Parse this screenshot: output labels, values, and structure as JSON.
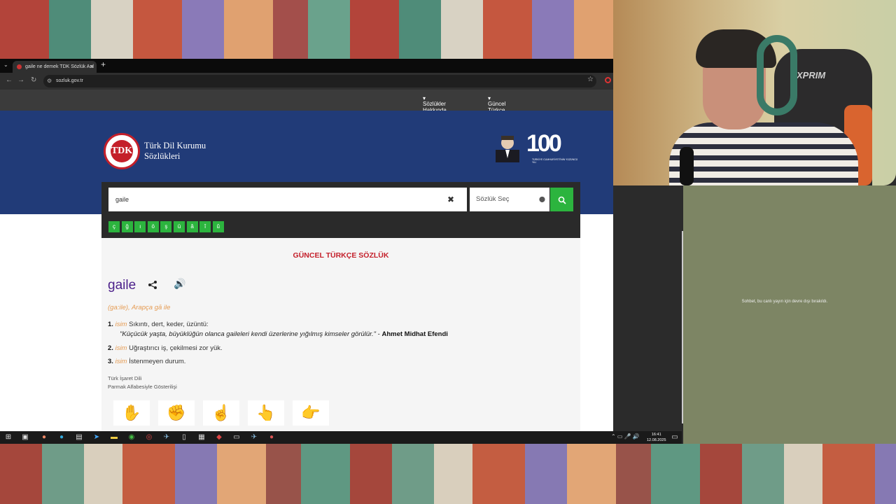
{
  "browser": {
    "tab_title": "gaile ne demek TDK Sözlük Anl",
    "url": "sozluk.gov.tr"
  },
  "site_nav": {
    "about_dictionaries": "Sözlükler Hakkında",
    "about_current": "Güncel Türkçe Sözlük Hakkında"
  },
  "brand": {
    "logo_year": "1932",
    "line1": "Türk Dil Kurumu",
    "line2": "Sözlükleri",
    "centennial": "100",
    "centennial_sub": "TÜRKİYE CUMHURİYETİ'NİN YÜZÜNCÜ YILI"
  },
  "search": {
    "query": "gaile",
    "clear_label": "✖",
    "dict_select": "Sözlük Seç",
    "letters": [
      "ç",
      "ğ",
      "ı",
      "ö",
      "ş",
      "ü",
      "â",
      "î",
      "û"
    ]
  },
  "entry": {
    "dictionary_title": "GÜNCEL TÜRKÇE SÖZLÜK",
    "word": "gaile",
    "etymology": "(ga:ile), Arapça gā ile",
    "senses": [
      {
        "num": "1.",
        "pos": "isim",
        "text": "Sıkıntı, dert, keder, üzüntü:"
      },
      {
        "num": "2.",
        "pos": "isim",
        "text": "Uğraştırıcı iş, çekilmesi zor yük."
      },
      {
        "num": "3.",
        "pos": "isim",
        "text": "İstenmeyen durum."
      }
    ],
    "example": {
      "text": "\"Küçücük yaşta, büyüklüğün olanca gaileleri kendi üzerlerine yığılmış kimseler görülür.\"",
      "sep": " - ",
      "author": "Ahmet Midhat Efendi"
    },
    "sign_language_title": "Türk İşaret Dili",
    "sign_language_sub": "Parmak Alfabesiyle Gösterilişi"
  },
  "taskbar": {
    "time": "16:41",
    "date": "12.08.2025"
  },
  "chat": {
    "message": "Sohbet, bu canlı yayın için devre dışı bırakıldı."
  },
  "webcam": {
    "chair_logo": "XPRIM"
  }
}
